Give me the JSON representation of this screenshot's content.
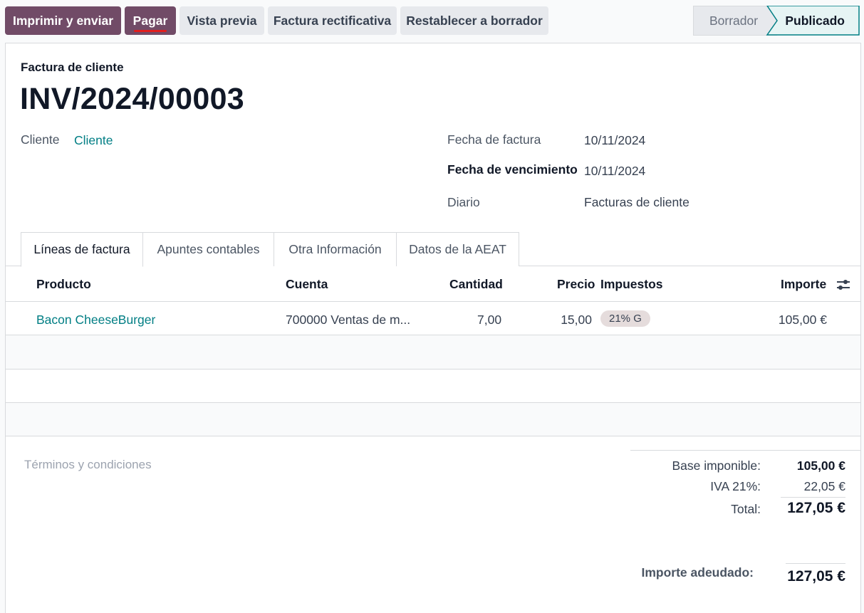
{
  "toolbar": {
    "print_send": "Imprimir y enviar",
    "pay": "Pagar",
    "preview": "Vista previa",
    "credit_note": "Factura rectificativa",
    "reset_draft": "Restablecer a borrador"
  },
  "status": {
    "draft": "Borrador",
    "posted": "Publicado"
  },
  "invoice": {
    "type_label": "Factura de cliente",
    "number": "INV/2024/00003",
    "customer_label": "Cliente",
    "customer_value": "Cliente",
    "invoice_date_label": "Fecha de factura",
    "invoice_date": "10/11/2024",
    "due_date_label": "Fecha de vencimiento",
    "due_date": "10/11/2024",
    "journal_label": "Diario",
    "journal": "Facturas de cliente"
  },
  "tabs": [
    {
      "label": "Líneas de factura"
    },
    {
      "label": "Apuntes contables"
    },
    {
      "label": "Otra Información"
    },
    {
      "label": "Datos de la AEAT"
    }
  ],
  "table": {
    "headers": {
      "product": "Producto",
      "account": "Cuenta",
      "quantity": "Cantidad",
      "price": "Precio",
      "taxes": "Impuestos",
      "amount": "Importe"
    },
    "lines": [
      {
        "product": "Bacon CheeseBurger",
        "account": "700000 Ventas de m...",
        "quantity": "7,00",
        "price": "15,00",
        "tax": "21% G",
        "amount": "105,00 €"
      }
    ]
  },
  "terms_placeholder": "Términos y condiciones",
  "totals": {
    "base_label": "Base imponible:",
    "base_value": "105,00 €",
    "vat_label": "IVA 21%:",
    "vat_value": "22,05 €",
    "total_label": "Total:",
    "total_value": "127,05 €",
    "due_label": "Importe adeudado:",
    "due_value": "127,05 €"
  },
  "colors": {
    "primary": "#714b67",
    "link": "#017e84",
    "underline_annotation": "#e11d1d"
  }
}
